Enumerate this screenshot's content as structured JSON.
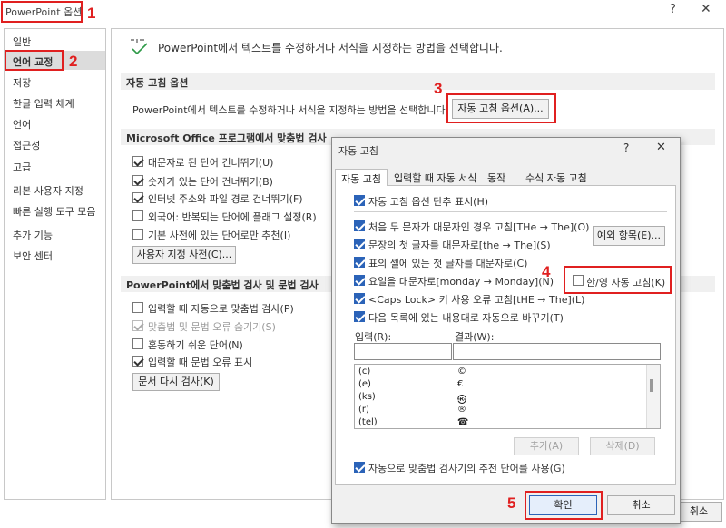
{
  "window": {
    "title": "PowerPoint 옵션",
    "help": "?",
    "close": "✕"
  },
  "annotations": {
    "n1": "1",
    "n2": "2",
    "n3": "3",
    "n4": "4",
    "n5": "5"
  },
  "sidebar": {
    "items": [
      {
        "label": "일반"
      },
      {
        "label": "언어 교정"
      },
      {
        "label": "저장"
      },
      {
        "label": "한글 입력 체계"
      },
      {
        "label": "언어"
      },
      {
        "label": "접근성"
      },
      {
        "label": "고급"
      },
      {
        "label": "리본 사용자 지정"
      },
      {
        "label": "빠른 실행 도구 모음"
      },
      {
        "label": "추가 기능"
      },
      {
        "label": "보안 센터"
      }
    ]
  },
  "main": {
    "intro": "PowerPoint에서 텍스트를 수정하거나 서식을 지정하는 방법을 선택합니다.",
    "autocorrect_header": "자동 고침 옵션",
    "autocorrect_desc": "PowerPoint에서 텍스트를 수정하거나 서식을 지정하는 방법을 선택합니다.",
    "autocorrect_btn": "자동 고침 옵션(A)...",
    "office_header": "Microsoft Office 프로그램에서 맞춤법 검사",
    "office_opts": [
      {
        "label": "대문자로 된 단어 건너뛰기(U)",
        "checked": true
      },
      {
        "label": "숫자가 있는 단어 건너뛰기(B)",
        "checked": true
      },
      {
        "label": "인터넷 주소와 파일 경로 건너뛰기(F)",
        "checked": true
      },
      {
        "label": "외국어: 반복되는 단어에 플래그 설정(R)",
        "checked": false
      },
      {
        "label": "기본 사전에 있는 단어로만 추천(I)",
        "checked": false
      }
    ],
    "custom_dict_btn": "사용자 지정 사전(C)...",
    "ppt_header": "PowerPoint에서 맞춤법 검사 및 문법 검사",
    "ppt_opts": [
      {
        "label": "입력할 때 자동으로 맞춤법 검사(P)",
        "checked": false
      },
      {
        "label": "맞춤법 및 문법 오류 숨기기(S)",
        "checked": true
      },
      {
        "label": "혼동하기 쉬운 단어(N)",
        "checked": false
      },
      {
        "label": "입력할 때 문법 오류 표시",
        "checked": true
      }
    ],
    "recheck_btn": "문서 다시 검사(K)",
    "cancel_peek": "취소"
  },
  "dialog": {
    "title": "자동 고침",
    "help": "?",
    "close": "✕",
    "tabs": [
      {
        "label": "자동 고침"
      },
      {
        "label": "입력할 때 자동 서식"
      },
      {
        "label": "동작"
      },
      {
        "label": "수식 자동 고침"
      }
    ],
    "show_buttons": "자동 고침 옵션 단추 표시(H)",
    "opts": [
      {
        "label": "처음 두 문자가 대문자인 경우 고침[THe → The](O)",
        "checked": true
      },
      {
        "label": "문장의 첫 글자를 대문자로[the → The](S)",
        "checked": true
      },
      {
        "label": "표의 셀에 있는 첫 글자를 대문자로(C)",
        "checked": true
      },
      {
        "label": "요일을 대문자로[monday → Monday](N)",
        "checked": true
      },
      {
        "label": "<Caps Lock> 키 사용 오류 고침[tHE → The](L)",
        "checked": true
      }
    ],
    "exceptions_btn": "예외 항목(E)...",
    "hanyoung": "한/영 자동 고침(K)",
    "replace_as_typed": "다음 목록에 있는 내용대로 자동으로 바꾸기(T)",
    "input_label": "입력(R):",
    "result_label": "결과(W):",
    "entries": [
      {
        "input": "(c)",
        "result": "©"
      },
      {
        "input": "(e)",
        "result": "€"
      },
      {
        "input": "(ks)",
        "result": "㉿"
      },
      {
        "input": "(r)",
        "result": "®"
      },
      {
        "input": "(tel)",
        "result": "☎"
      }
    ],
    "add_btn": "추가(A)",
    "delete_btn": "삭제(D)",
    "suggest": "자동으로 맞춤법 검사기의 추천 단어를 사용(G)",
    "ok_btn": "확인",
    "cancel_btn": "취소"
  },
  "colors": {
    "accent": "#2b63b8",
    "annotation": "#e02020"
  }
}
